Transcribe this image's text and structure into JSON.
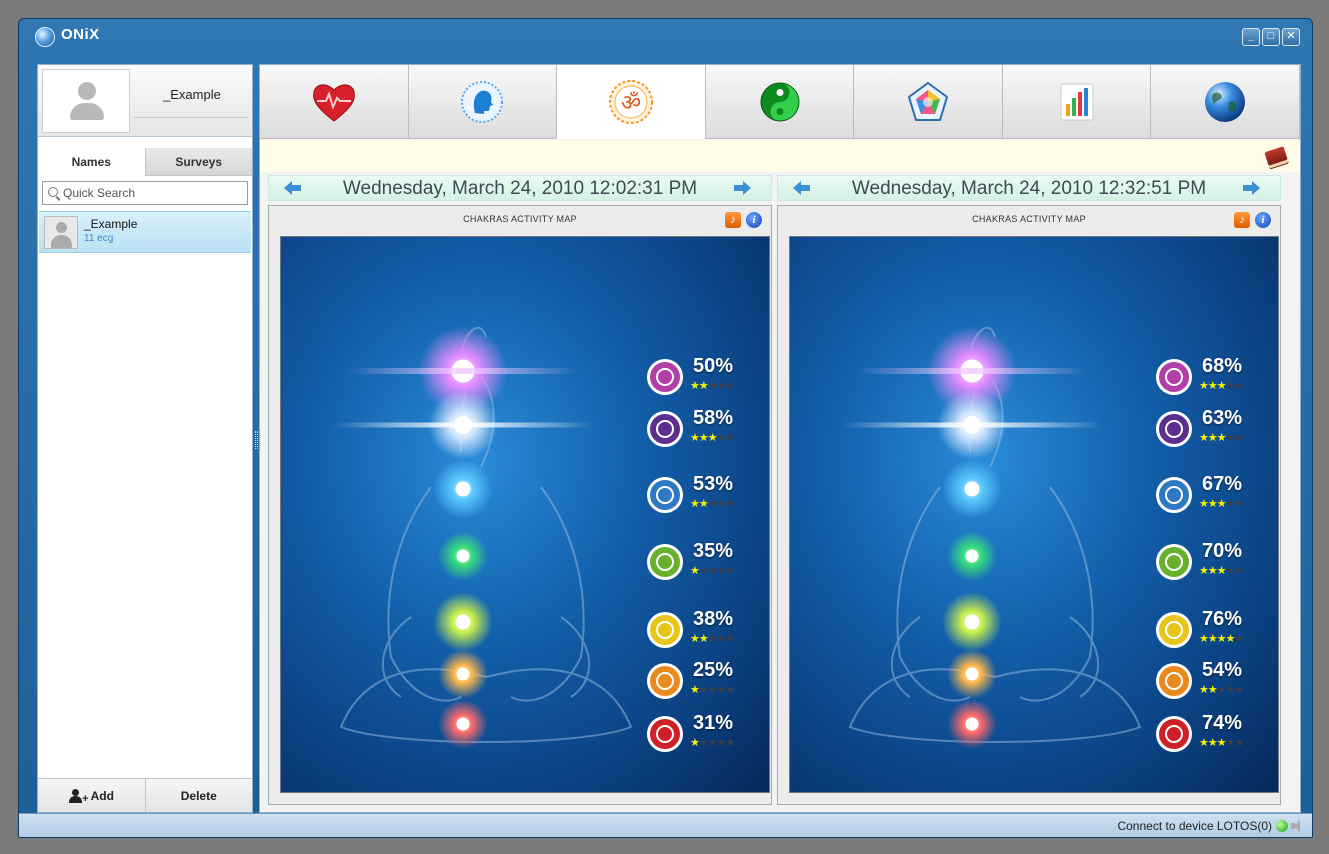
{
  "window": {
    "title": "ONiX",
    "buttons": [
      "_",
      "□",
      "✕"
    ]
  },
  "profile": {
    "name": "_Example"
  },
  "left_tabs": [
    {
      "label": "Names",
      "active": true
    },
    {
      "label": "Surveys",
      "active": false
    }
  ],
  "search": {
    "placeholder": "Quick Search",
    "value": ""
  },
  "list": [
    {
      "name": "_Example",
      "subtitle": "11 ecg"
    }
  ],
  "footer": {
    "add_label": "Add",
    "delete_label": "Delete"
  },
  "main_tabs": [
    {
      "icon": "heart-icon",
      "active": false
    },
    {
      "icon": "head-profile-icon",
      "active": false
    },
    {
      "icon": "om-icon",
      "active": true
    },
    {
      "icon": "yin-yang-icon",
      "active": false
    },
    {
      "icon": "pentagon-icon",
      "active": false
    },
    {
      "icon": "bar-chart-icon",
      "active": false
    },
    {
      "icon": "globe-icon",
      "active": false
    }
  ],
  "panels": [
    {
      "date": "Wednesday, March 24, 2010 12:02:31 PM",
      "title": "CHAKRAS ACTIVITY MAP",
      "chakras": [
        {
          "percent": "50%",
          "stars": 2,
          "color": "#b23ea8"
        },
        {
          "percent": "58%",
          "stars": 3,
          "color": "#5b2f8d"
        },
        {
          "percent": "53%",
          "stars": 2,
          "color": "#2f78c4"
        },
        {
          "percent": "35%",
          "stars": 1,
          "color": "#68b12f"
        },
        {
          "percent": "38%",
          "stars": 2,
          "color": "#e8c51a"
        },
        {
          "percent": "25%",
          "stars": 1,
          "color": "#ea8a1c"
        },
        {
          "percent": "31%",
          "stars": 1,
          "color": "#cf2027"
        }
      ]
    },
    {
      "date": "Wednesday, March 24, 2010 12:32:51 PM",
      "title": "CHAKRAS ACTIVITY MAP",
      "chakras": [
        {
          "percent": "68%",
          "stars": 3,
          "color": "#b23ea8"
        },
        {
          "percent": "63%",
          "stars": 3,
          "color": "#5b2f8d"
        },
        {
          "percent": "67%",
          "stars": 3,
          "color": "#2f78c4"
        },
        {
          "percent": "70%",
          "stars": 3,
          "color": "#68b12f"
        },
        {
          "percent": "76%",
          "stars": 4,
          "color": "#e8c51a"
        },
        {
          "percent": "54%",
          "stars": 2,
          "color": "#ea8a1c"
        },
        {
          "percent": "74%",
          "stars": 3,
          "color": "#cf2027"
        }
      ]
    }
  ],
  "status": {
    "text": "Connect to device LOTOS(0)"
  }
}
